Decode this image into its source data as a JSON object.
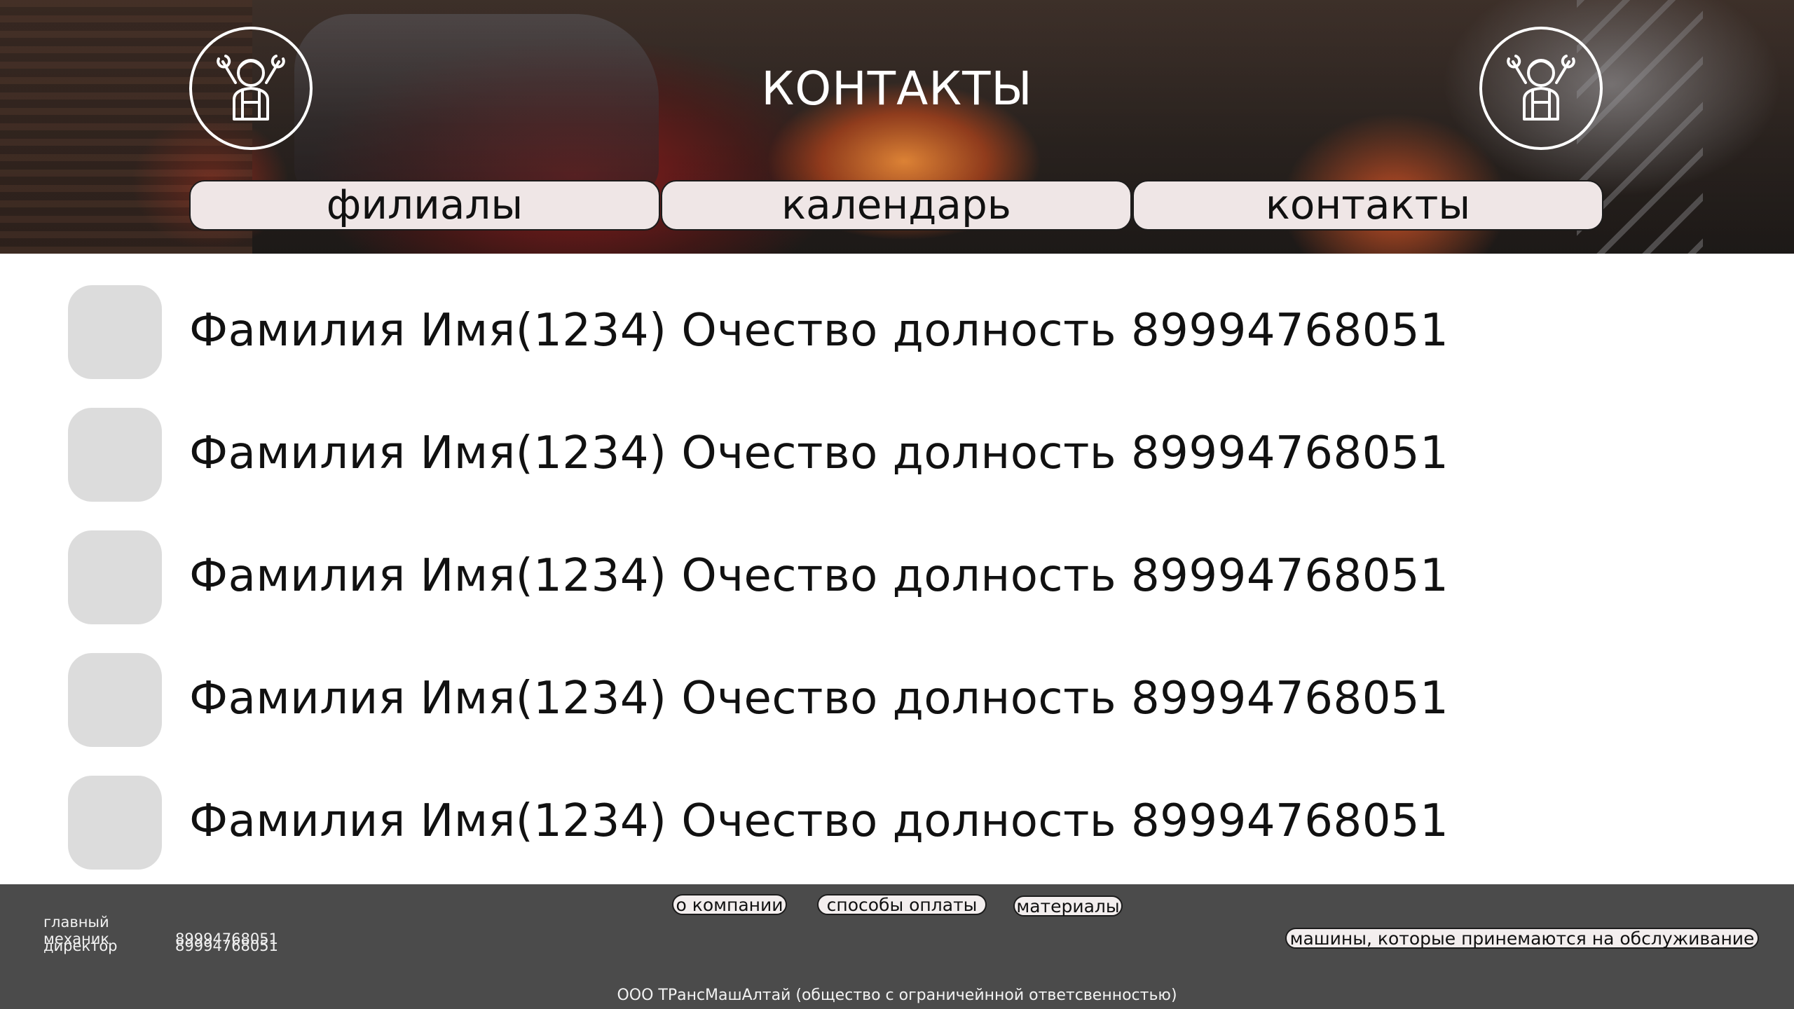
{
  "header": {
    "title": "КОНТАКТЫ",
    "logo_icon": "mechanic-icon",
    "tabs": [
      {
        "label": "филиалы"
      },
      {
        "label": "календарь"
      },
      {
        "label": "контакты"
      }
    ]
  },
  "contacts": [
    {
      "text": "Фамилия Имя(1234) Очество долность 89994768051"
    },
    {
      "text": "Фамилия Имя(1234) Очество долность 89994768051"
    },
    {
      "text": "Фамилия Имя(1234) Очество долность 89994768051"
    },
    {
      "text": "Фамилия Имя(1234) Очество долность 89994768051"
    },
    {
      "text": "Фамилия Имя(1234) Очество долность 89994768051"
    }
  ],
  "footer": {
    "info": [
      {
        "label": "главный механик",
        "phone": "89994768051"
      },
      {
        "label": "директор",
        "phone": "89994768051"
      }
    ],
    "links": [
      {
        "label": "о компании"
      },
      {
        "label": "способы оплаты"
      },
      {
        "label": "материалы"
      },
      {
        "label": "машины, которые принемаются на обслуживание"
      }
    ],
    "copyright": "ООО ТРансМашАлтай (общество с ограничейнной ответсвенностью)"
  },
  "colors": {
    "tab_bg": "#efe6e6",
    "avatar_bg": "#dcdcdc",
    "footer_bg": "#4b4b4b"
  }
}
